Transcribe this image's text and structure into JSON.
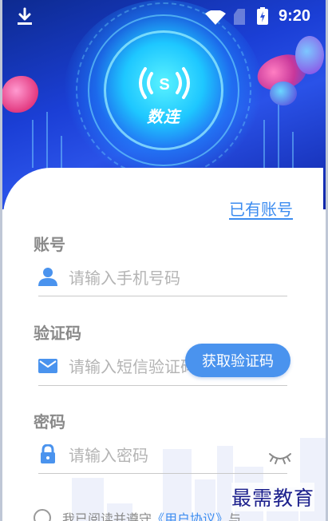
{
  "status_bar": {
    "time": "9:20",
    "icons": [
      "download-icon",
      "wifi-icon",
      "sim-icon",
      "battery-charging-icon"
    ]
  },
  "brand": {
    "logo_text": "数连",
    "logo_symbol": "(S)"
  },
  "form": {
    "have_account_link": "已有账号",
    "account": {
      "label": "账号",
      "placeholder": "请输入手机号码",
      "icon": "user-icon"
    },
    "verification": {
      "label": "验证码",
      "placeholder": "请输入短信验证码",
      "icon": "mail-icon",
      "button_label": "获取验证码"
    },
    "password": {
      "label": "密码",
      "placeholder": "请输入密码",
      "icon": "lock-icon",
      "toggle_icon": "eye-closed-icon"
    },
    "agreement": {
      "prefix": "我已阅读并遵守",
      "link": "《用户协议》",
      "suffix": "与"
    }
  },
  "watermark": "最需教育",
  "colors": {
    "accent": "#4a93ee",
    "link": "#3c8cf0",
    "hero_primary": "#1b3fd6",
    "watermark": "#1b1f8c"
  }
}
